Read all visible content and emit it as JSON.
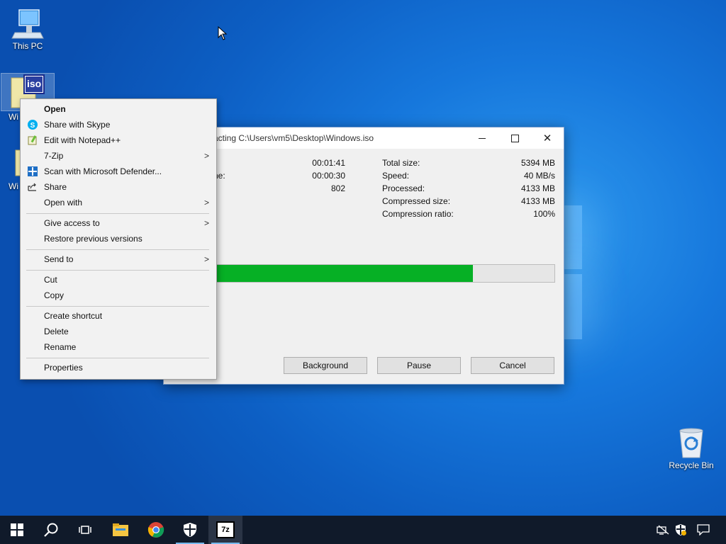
{
  "desktop": {
    "icons": [
      {
        "name": "this-pc",
        "label": "This PC"
      },
      {
        "name": "windows-iso",
        "label": "Wi"
      },
      {
        "name": "second-file",
        "label": "Wi"
      },
      {
        "name": "recycle-bin",
        "label": "Recycle Bin"
      }
    ],
    "iso_badge": "iso"
  },
  "progress_window": {
    "title": "acting C:\\Users\\vm5\\Desktop\\Windows.iso",
    "left_labels": [
      "",
      "ne:",
      ""
    ],
    "left_values": [
      "00:01:41",
      "00:00:30",
      "802"
    ],
    "right_labels": [
      "Total size:",
      "Speed:",
      "Processed:",
      "Compressed size:",
      "Compression ratio:"
    ],
    "right_values": [
      "5394 MB",
      "40 MB/s",
      "4133 MB",
      "4133 MB",
      "100%"
    ],
    "progress": 0.766,
    "buttons": {
      "background": "Background",
      "pause": "Pause",
      "cancel": "Cancel"
    },
    "colors": {
      "progress_fill": "#06b025"
    }
  },
  "context_menu": {
    "items": [
      {
        "label": "Open",
        "bold": true
      },
      {
        "label": "Share with Skype",
        "icon": "skype-icon"
      },
      {
        "label": "Edit with Notepad++",
        "icon": "notepad-plus-plus-icon"
      },
      {
        "label": "7-Zip",
        "submenu": true
      },
      {
        "label": "Scan with Microsoft Defender...",
        "icon": "defender-icon"
      },
      {
        "label": "Share",
        "icon": "share-icon"
      },
      {
        "label": "Open with",
        "submenu": true
      },
      {
        "label": "Give access to",
        "submenu": true
      },
      {
        "label": "Restore previous versions"
      },
      {
        "label": "Send to",
        "submenu": true
      },
      {
        "label": "Cut"
      },
      {
        "label": "Copy"
      },
      {
        "label": "Create shortcut"
      },
      {
        "label": "Delete"
      },
      {
        "label": "Rename"
      },
      {
        "label": "Properties"
      }
    ]
  },
  "taskbar": {
    "seven_zip_badge": "7z",
    "items": [
      "start-icon",
      "search-icon",
      "task-view-icon",
      "file-explorer-icon",
      "chrome-icon",
      "windows-security-icon",
      "seven-zip-icon"
    ],
    "tray": [
      "network-disconnected-icon",
      "security-warning-icon",
      "notifications-icon"
    ]
  }
}
